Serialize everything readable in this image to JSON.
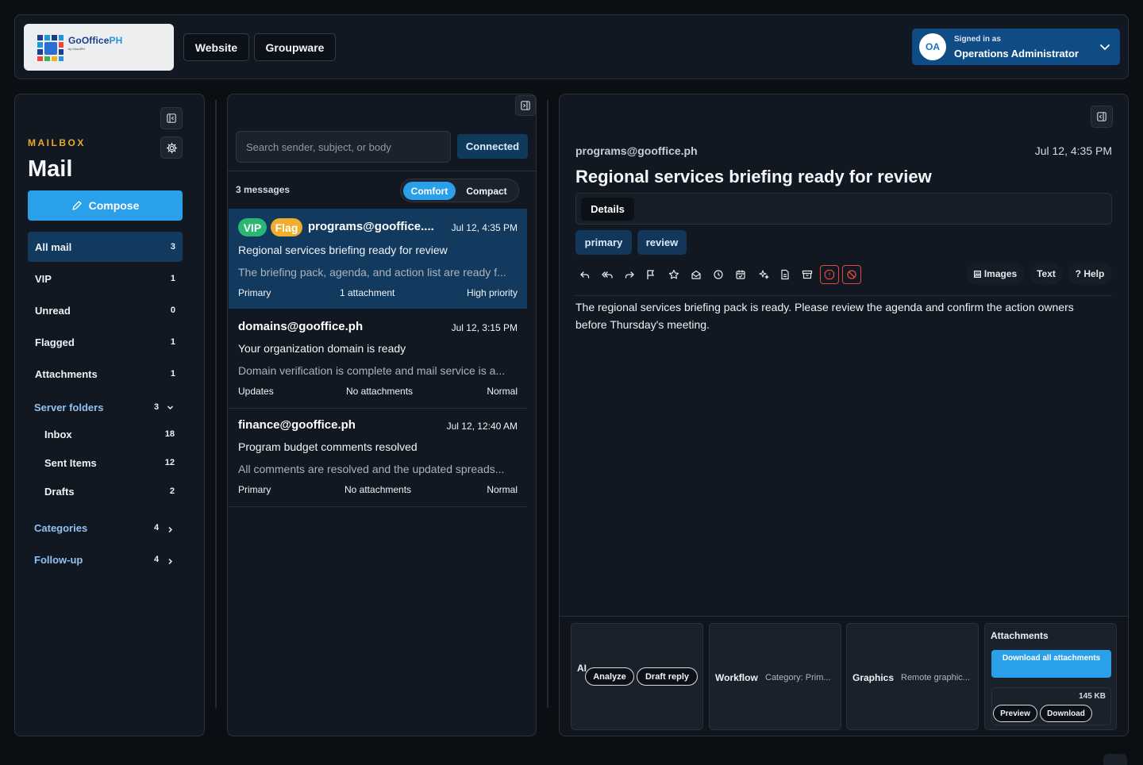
{
  "brand": {
    "name_main": "GoOffice",
    "name_accent": "PH",
    "tagline": "by KloudPH"
  },
  "topnav": {
    "website": "Website",
    "groupware": "Groupware"
  },
  "user": {
    "initials": "OA",
    "signed_in_label": "Signed in as",
    "name": "Operations Administrator"
  },
  "sidebar": {
    "eyebrow": "MAILBOX",
    "title": "Mail",
    "compose": "Compose",
    "items": [
      {
        "label": "All mail",
        "count": "3"
      },
      {
        "label": "VIP",
        "count": "1"
      },
      {
        "label": "Unread",
        "count": "0"
      },
      {
        "label": "Flagged",
        "count": "1"
      },
      {
        "label": "Attachments",
        "count": "1"
      }
    ],
    "server_folders": {
      "label": "Server folders",
      "count": "3",
      "items": [
        {
          "label": "Inbox",
          "count": "18"
        },
        {
          "label": "Sent Items",
          "count": "12"
        },
        {
          "label": "Drafts",
          "count": "2"
        }
      ]
    },
    "categories": {
      "label": "Categories",
      "count": "4"
    },
    "followup": {
      "label": "Follow-up",
      "count": "4"
    }
  },
  "list": {
    "search_placeholder": "Search sender, subject, or body",
    "status": "Connected",
    "count_label": "3 messages",
    "density": {
      "comfort": "Comfort",
      "compact": "Compact",
      "active": "Comfort"
    },
    "messages": [
      {
        "badges": [
          "VIP",
          "Flag"
        ],
        "from": "programs@gooffice....",
        "date": "Jul 12, 4:35 PM",
        "subject": "Regional services briefing ready for review",
        "preview": "The briefing pack, agenda, and action list are ready f...",
        "category": "Primary",
        "attachments": "1 attachment",
        "priority": "High priority",
        "selected": true
      },
      {
        "badges": [],
        "from": "domains@gooffice.ph",
        "date": "Jul 12, 3:15 PM",
        "subject": "Your organization domain is ready",
        "preview": "Domain verification is complete and mail service is a...",
        "category": "Updates",
        "attachments": "No attachments",
        "priority": "Normal",
        "selected": false
      },
      {
        "badges": [],
        "from": "finance@gooffice.ph",
        "date": "Jul 12, 12:40 AM",
        "subject": "Program budget comments resolved",
        "preview": "All comments are resolved and the updated spreads...",
        "category": "Primary",
        "attachments": "No attachments",
        "priority": "Normal",
        "selected": false
      }
    ]
  },
  "reader": {
    "from": "programs@gooffice.ph",
    "date": "Jul 12, 4:35 PM",
    "subject": "Regional services briefing ready for review",
    "details": "Details",
    "tags": [
      "primary",
      "review"
    ],
    "toolbar_icons": [
      "reply-icon",
      "reply-all-icon",
      "forward-icon",
      "flag-icon",
      "star-icon",
      "mark-read-icon",
      "snooze-icon",
      "calendar-icon",
      "ai-sparkle-icon",
      "note-icon",
      "archive-icon",
      "report-icon",
      "block-icon"
    ],
    "view_images": "Images",
    "view_text": "Text",
    "help": "? Help",
    "body": "The regional services briefing pack is ready. Please review the agenda and confirm the action owners before Thursday's meeting.",
    "ai": {
      "label": "AI",
      "analyze": "Analyze",
      "draft_reply": "Draft reply"
    },
    "workflow": {
      "label": "Workflow",
      "value": "Category: Prim..."
    },
    "graphics": {
      "label": "Graphics",
      "value": "Remote graphic..."
    },
    "attachments": {
      "title": "Attachments",
      "download_all": "Download all attachments",
      "size": "145 KB",
      "preview": "Preview",
      "download": "Download"
    }
  },
  "colors": {
    "accent": "#2aa0ea",
    "selected": "#123a5f",
    "vip": "#2bb673",
    "flag": "#f0ad2e",
    "danger": "#e04b3f",
    "eyebrow": "#e8a82f"
  }
}
